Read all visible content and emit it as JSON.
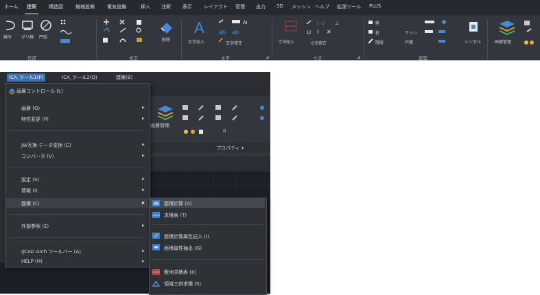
{
  "ribbon": {
    "tabs": [
      "ホーム",
      "建築",
      "構造図",
      "機械設備",
      "電気設備",
      "挿入",
      "注釈",
      "表示",
      "レイアウト",
      "管理",
      "出力",
      "3D",
      "メッシュ",
      "ヘルプ",
      "拡張ツール",
      "PLUS"
    ],
    "active_tab": "建築",
    "groups": [
      "作成",
      "修正",
      "文字",
      "寸法",
      "建築"
    ],
    "buttons": {
      "line": "線分",
      "polyline": "ポリ線",
      "circle": "円弧",
      "erase": "削除",
      "text": "文字記入",
      "text_edit": "文字修正",
      "dim": "寸法記入",
      "dim_edit": "寸法修正",
      "symbol": "シンボル",
      "layer": "画層管理",
      "wall": "壁",
      "column": "柱",
      "sash": "サッシ",
      "door": "戸開",
      "stair": "階段"
    }
  },
  "menubar": {
    "items": [
      "ICA_ツール1(P)",
      "ICA_ツール2(Q)",
      "建築(B)"
    ]
  },
  "fragment": {
    "layer_label": "画層管理",
    "properties": "プロパティ ▾",
    "layer_value": "0"
  },
  "menu": {
    "items": [
      {
        "label": "画層コントロール (L)"
      },
      {
        "label": "画層 (G)"
      },
      {
        "label": "特性変更 (P)"
      },
      {
        "label": "JW互換 データ変換 (C)"
      },
      {
        "label": "コンバータ (V)"
      },
      {
        "label": "設定 (S)"
      },
      {
        "label": "情報 (I)"
      },
      {
        "label": "面積 (C)"
      },
      {
        "label": "外部参照 (E)"
      },
      {
        "label": "IJCAD Arch ツールバー (A)"
      },
      {
        "label": "HELP (H)"
      }
    ]
  },
  "submenu": {
    "items": [
      {
        "label": "面積計算 (A)"
      },
      {
        "label": "求積表 (T)"
      },
      {
        "label": "面積計算属性記入 (I)"
      },
      {
        "label": "面積属性抽出 (G)"
      },
      {
        "label": "敷地求積表 (K)"
      },
      {
        "label": "領域三斜求積 (S)"
      }
    ]
  },
  "colors": {
    "accent": "#3e8fd8",
    "menu_bg": "#2e3136",
    "highlight": "#44484f"
  }
}
